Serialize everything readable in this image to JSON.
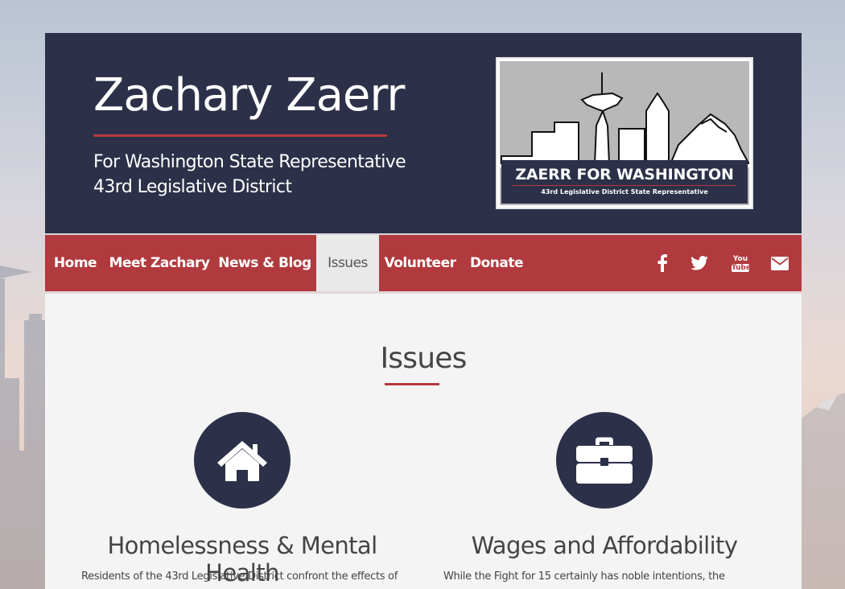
{
  "header": {
    "title": "Zachary Zaerr",
    "subtitle_line1": "For Washington State Representative",
    "subtitle_line2": "43rd Legislative District",
    "logo": {
      "main_text": "ZAERR FOR WASHINGTON",
      "sub_text": "43rd Legislative District State Representative"
    }
  },
  "nav": {
    "items": [
      {
        "label": "Home"
      },
      {
        "label": "Meet Zachary"
      },
      {
        "label": "News & Blog"
      },
      {
        "label": "Issues",
        "active": true
      },
      {
        "label": "Volunteer"
      },
      {
        "label": "Donate"
      }
    ],
    "social_icons": [
      "facebook-icon",
      "twitter-icon",
      "youtube-icon",
      "email-icon"
    ],
    "youtube_text_top": "You",
    "youtube_text_bottom": "Tube"
  },
  "main": {
    "heading": "Issues",
    "issues": [
      {
        "icon": "home-icon",
        "title": "Homelessness & Mental Health",
        "body": "Residents of the 43rd Legislative District confront the effects of"
      },
      {
        "icon": "briefcase-icon",
        "title": "Wages and Affordability",
        "body": "While the Fight for 15 certainly has noble intentions, the"
      }
    ]
  },
  "colors": {
    "navy": "#2c3048",
    "red": "#b03a3e",
    "content_bg": "#f4f4f4"
  }
}
